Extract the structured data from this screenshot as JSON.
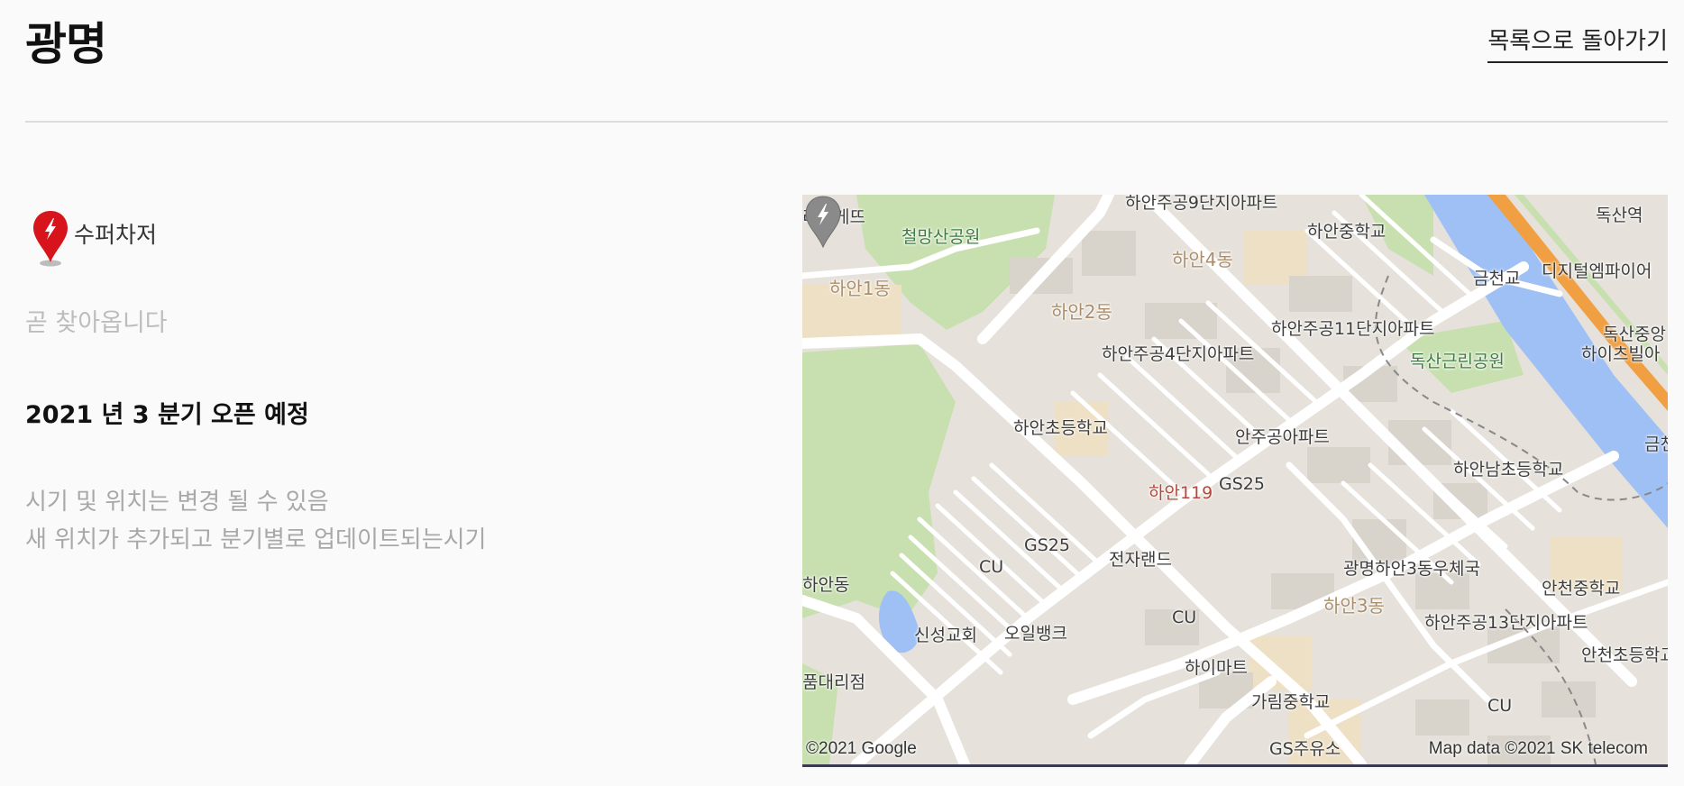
{
  "header": {
    "title": "광명",
    "back_link": "목록으로 돌아가기"
  },
  "station": {
    "charger_type": "수퍼차저",
    "status": "곧 찾아옵니다",
    "open_schedule": "2021 년 3 분기 오픈 예정",
    "notice_lines": [
      "시기 및 위치는 변경 될 수 있음",
      "새 위치가 추가되고 분기별로 업데이트되는시기"
    ]
  },
  "colors": {
    "pin_red": "#d7141c",
    "pin_gray": "#8a8a8a",
    "river": "#9fc0f5",
    "highway": "#f0a042",
    "park": "#c8e0b0"
  },
  "map": {
    "labels": [
      "하안주공9단지아파트",
      "리바게뜨",
      "철망산공원",
      "하안중학교",
      "독산역",
      "하안4동",
      "하안1동",
      "하안2동",
      "금천교",
      "디지털엠파이어",
      "하안주공11단지아파트",
      "독산중앙",
      "하이츠빌아",
      "하안주공4단지아파트",
      "독산근린공원",
      "하안초등학교",
      "안주공아파트",
      "하안남초등학교",
      "금천",
      "하안119",
      "GS25",
      "GS25",
      "CU",
      "전자랜드",
      "광명하안3동우체국",
      "하안동",
      "안천중학교",
      "하안3동",
      "신성교회",
      "오일뱅크",
      "CU",
      "하안주공13단지아파트",
      "안천초등학교",
      "품대리점",
      "하이마트",
      "가림중학교",
      "CU",
      "GS주유소"
    ],
    "copyright_left": "©2021 Google",
    "copyright_right": "Map data ©2021 SK telecom"
  },
  "icons": {
    "charger_pin": "supercharger-pin-icon",
    "map_marker": "map-marker-icon"
  }
}
